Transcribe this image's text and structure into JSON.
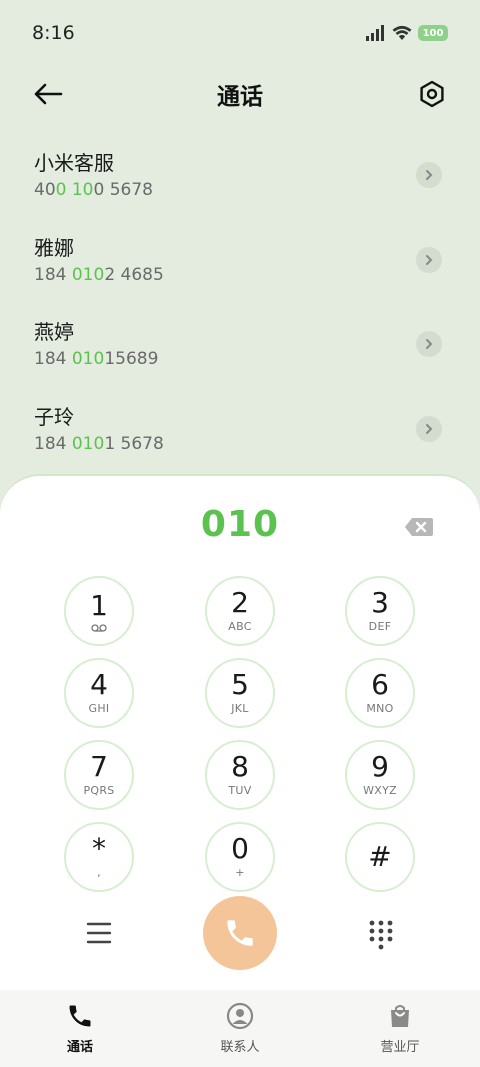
{
  "status_bar": {
    "time": "8:16",
    "battery": "100"
  },
  "header": {
    "title": "通话"
  },
  "matches": [
    {
      "name": "小米客服",
      "number_parts": [
        "40",
        "0 10",
        "0 5678"
      ]
    },
    {
      "name": "雅娜",
      "number_parts": [
        "184 ",
        "010",
        "2 4685"
      ]
    },
    {
      "name": "燕婷",
      "number_parts": [
        "184 ",
        "010",
        "15689"
      ]
    },
    {
      "name": "子玲",
      "number_parts": [
        "184 ",
        "010",
        "1 5678"
      ]
    }
  ],
  "dialer": {
    "input": "010",
    "keys": [
      {
        "digit": "1",
        "letters": ""
      },
      {
        "digit": "2",
        "letters": "ABC"
      },
      {
        "digit": "3",
        "letters": "DEF"
      },
      {
        "digit": "4",
        "letters": "GHI"
      },
      {
        "digit": "5",
        "letters": "JKL"
      },
      {
        "digit": "6",
        "letters": "MNO"
      },
      {
        "digit": "7",
        "letters": "PQRS"
      },
      {
        "digit": "8",
        "letters": "TUV"
      },
      {
        "digit": "9",
        "letters": "WXYZ"
      },
      {
        "digit": "*",
        "letters": ","
      },
      {
        "digit": "0",
        "letters": "+"
      },
      {
        "digit": "#",
        "letters": ""
      }
    ]
  },
  "bottom_nav": [
    {
      "label": "通话",
      "icon": "phone-icon",
      "active": true
    },
    {
      "label": "联系人",
      "icon": "person-icon",
      "active": false
    },
    {
      "label": "营业厅",
      "icon": "shopping-bag-icon",
      "active": false
    }
  ],
  "colors": {
    "accent": "#5cc24f",
    "call": "#f4c598",
    "background": "#e3ecdf"
  }
}
